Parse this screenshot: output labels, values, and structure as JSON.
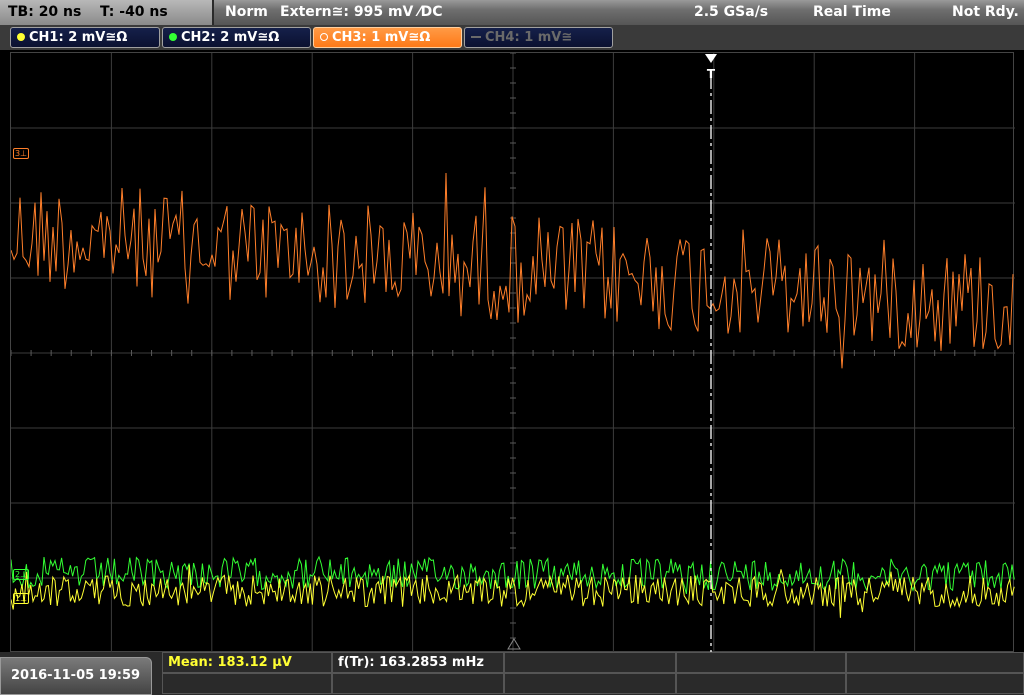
{
  "header": {
    "timebase": "TB: 20 ns",
    "trigger_time": "T: -40 ns",
    "mode": "Norm",
    "trigger_source": "Extern≅: 995 mV ⁄DC",
    "sample_rate": "2.5 GSa/s",
    "acq_mode": "Real Time",
    "status": "Not Rdy."
  },
  "channels": [
    {
      "id": "ch1",
      "label": "CH1: 2 mV≅Ω",
      "color": "#ffff33",
      "active": false,
      "enabled": true,
      "marker": "1"
    },
    {
      "id": "ch2",
      "label": "CH2: 2 mV≅Ω",
      "color": "#33ff33",
      "active": false,
      "enabled": true,
      "marker": "2"
    },
    {
      "id": "ch3",
      "label": "CH3: 1 mV≅Ω",
      "color": "#ff7f2a",
      "active": true,
      "enabled": true,
      "marker": "3"
    },
    {
      "id": "ch4",
      "label": "CH4: 1 mV≅",
      "color": "#6a6a6a",
      "active": false,
      "enabled": false,
      "marker": ""
    }
  ],
  "trigger_marker": "T",
  "measurements": {
    "mean": "Mean: 183.12 µV",
    "freq": "f(Tr): 163.2853 mHz"
  },
  "datetime": "2016-11-05 19:59",
  "colors": {
    "grid": "#3c3c3c",
    "ch1": "#ffff33",
    "ch2": "#33ff33",
    "ch3": "#ff7f2a",
    "trigger": "#ffffff"
  }
}
